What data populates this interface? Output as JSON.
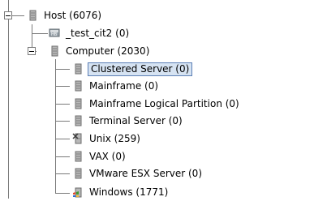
{
  "tree": {
    "root": {
      "label": "Host (6076)",
      "icon": "server-icon"
    },
    "items": [
      {
        "label": "_test_cit2 (0)",
        "icon": "host-group-icon"
      },
      {
        "label": "Computer (2030)",
        "icon": "server-icon"
      },
      {
        "label": "Clustered Server (0)",
        "icon": "server-icon",
        "selected": true
      },
      {
        "label": "Mainframe (0)",
        "icon": "server-icon"
      },
      {
        "label": "Mainframe Logical Partition (0)",
        "icon": "server-icon"
      },
      {
        "label": "Terminal Server (0)",
        "icon": "server-icon"
      },
      {
        "label": "Unix (259)",
        "icon": "unix-server-icon"
      },
      {
        "label": "VAX (0)",
        "icon": "server-icon"
      },
      {
        "label": "VMware ESX Server (0)",
        "icon": "server-icon"
      },
      {
        "label": "Windows (1771)",
        "icon": "windows-server-icon"
      }
    ]
  },
  "colors": {
    "selection_bg": "#d6e3f2",
    "selection_border": "#5b7fb5",
    "tree_line": "#7a7a7a"
  }
}
